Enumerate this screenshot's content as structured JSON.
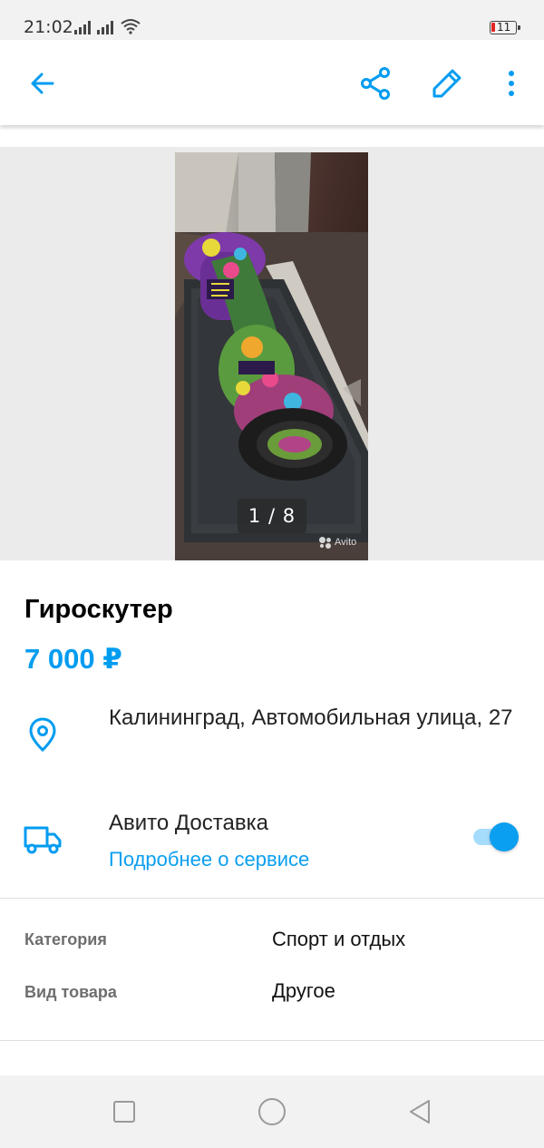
{
  "status_bar": {
    "time": "21:02",
    "battery": "11"
  },
  "toolbar": {
    "back_icon": "arrow-left-icon",
    "share_icon": "share-icon",
    "edit_icon": "pencil-icon",
    "more_icon": "more-vertical-icon",
    "accent_color": "#009cf0"
  },
  "gallery": {
    "counter": "1 / 8",
    "watermark": "Avito"
  },
  "listing": {
    "title": "Гироскутер",
    "price": "7 000 ₽",
    "address": "Калининград, Автомобильная улица, 27",
    "location_icon": "location-pin-icon"
  },
  "delivery": {
    "icon": "truck-icon",
    "title": "Авито Доставка",
    "link": "Подробнее о сервисе",
    "enabled": true
  },
  "params": [
    {
      "label": "Категория",
      "value": "Спорт и отдых"
    },
    {
      "label": "Вид товара",
      "value": "Другое"
    }
  ],
  "nav_bar": {
    "recents_icon": "square-icon",
    "home_icon": "circle-icon",
    "back_icon": "triangle-back-icon"
  }
}
